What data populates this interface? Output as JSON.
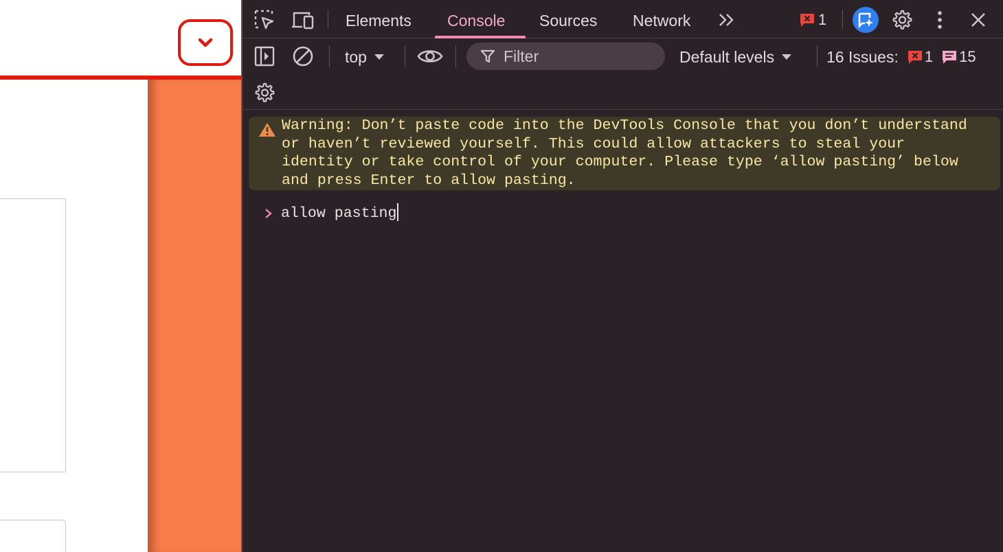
{
  "devtools": {
    "tabs": {
      "elements": "Elements",
      "console": "Console",
      "sources": "Sources",
      "network": "Network"
    },
    "error_badge_count": "1",
    "toolbar": {
      "context": "top",
      "filter_placeholder": "Filter",
      "levels": "Default levels",
      "issues_label": "16 Issues:",
      "issues_errors": "1",
      "issues_info": "15"
    },
    "console": {
      "warning_text": "Warning: Don’t paste code into the DevTools Console that you don’t understand or haven’t reviewed yourself. This could allow attackers to steal your identity or take control of your computer. Please type ‘allow pasting’ below and press Enter to allow pasting.",
      "input_value": "allow pasting"
    },
    "colors": {
      "background": "#2b2227",
      "accent": "#f08cb4",
      "warning_bg": "#3f3a27",
      "warning_text": "#f8e7a4",
      "error_red": "#e9453c",
      "ai_blue": "#2f7ff0"
    }
  },
  "page": {
    "colors": {
      "header_line": "#e11a10",
      "side_strip": "#f97d4a"
    }
  }
}
